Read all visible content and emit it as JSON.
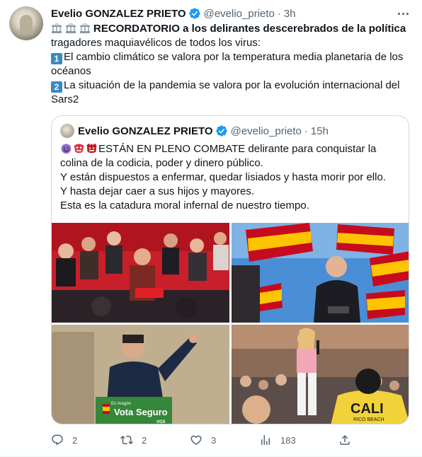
{
  "author": {
    "name": "Evelio GONZALEZ PRIETO",
    "handle": "@evelio_prieto",
    "separator": "·",
    "time": "3h"
  },
  "tweet": {
    "line1_title": "RECORDATORIO a los delirantes descerebrados de la política",
    "line2": "tragadores maquiavélicos de todos los virus:",
    "item1_num": "1",
    "item1": "El cambio climático se valora por la temperatura media planetaria de los océanos",
    "item2_num": "2",
    "item2": "La situación de la pandemia se valora por la evolución internacional del Sars2"
  },
  "quoted": {
    "name": "Evelio GONZALEZ PRIETO",
    "handle": "@evelio_prieto",
    "separator": "·",
    "time": "15h",
    "line1": "ESTÁN EN PLENO COMBATE delirante para conquistar la colina de la codicia, poder y dinero público.",
    "line2": "Y están dispuestos a enfermar, quedar lisiados y hasta morir por ello.",
    "line3": "Y hasta dejar caer a sus hijos y mayores.",
    "line4": "Esta es la catadura moral infernal de nuestro tiempo.",
    "images": [
      {
        "name": "photo-rally-red"
      },
      {
        "name": "photo-flags-speaker"
      },
      {
        "name": "photo-vox-speaker",
        "sign_small": "En Aragón",
        "sign_big": "Vota Seguro",
        "sign_brand": "VOX"
      },
      {
        "name": "photo-crowd-stage",
        "shirt_text": "CALI",
        "shirt_sub": "RICO BEACH"
      }
    ]
  },
  "actions": {
    "reply_count": "2",
    "retweet_count": "2",
    "like_count": "3",
    "views_count": "183"
  },
  "colors": {
    "verified": "#1d9bf0",
    "muted": "#536471",
    "number_key": "#3b88c3"
  }
}
